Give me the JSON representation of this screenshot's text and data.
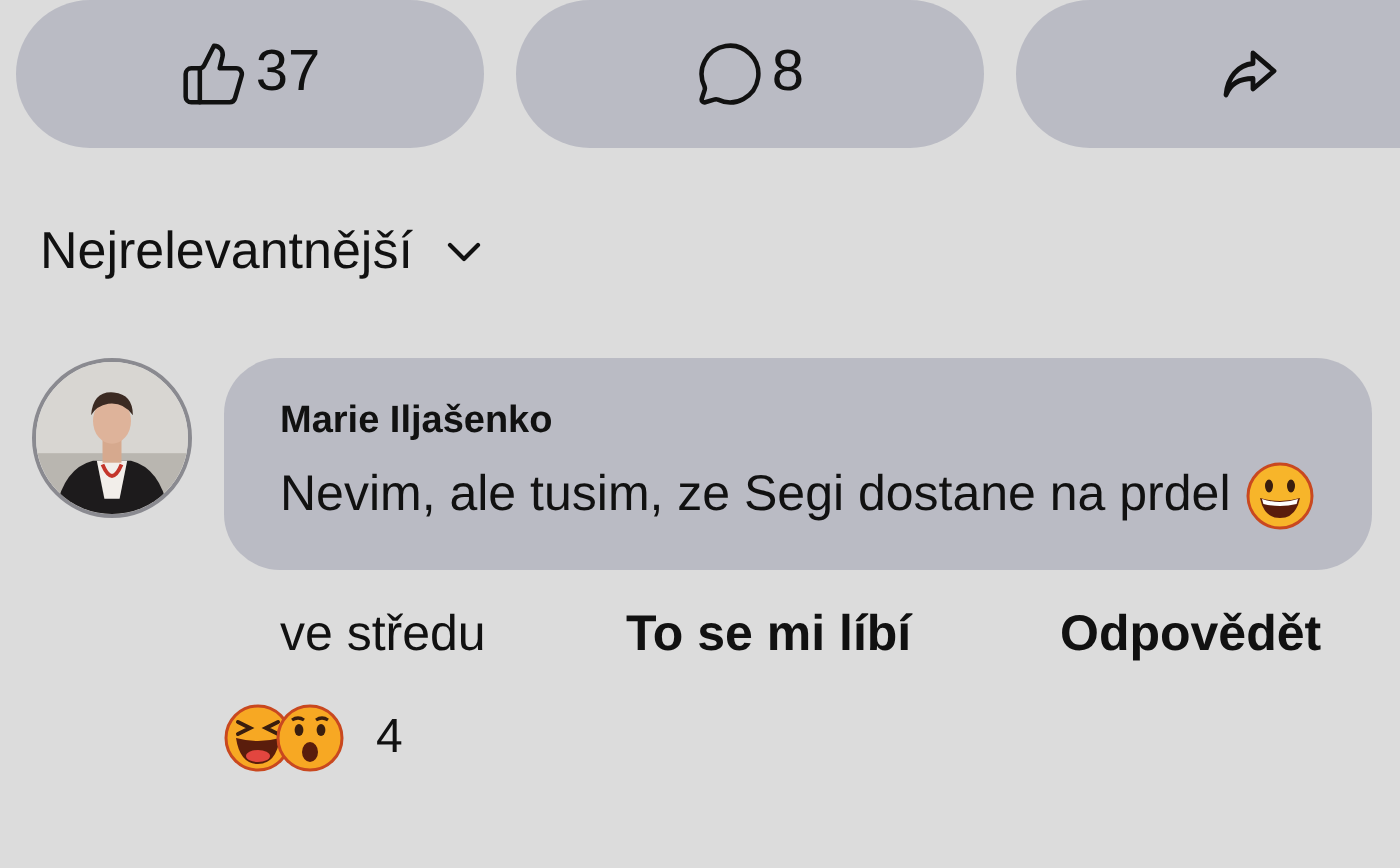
{
  "actions": [
    {
      "kind": "like",
      "label": "37"
    },
    {
      "kind": "comment",
      "label": "8"
    },
    {
      "kind": "share"
    }
  ],
  "sort": {
    "label": "Nejrelevantnější"
  },
  "comment": {
    "author": "Marie Iljašenko",
    "text": "Nevim, ale tusim, ze Segi dostane na prdel",
    "time": "ve středu",
    "like_label": "To se mi líbí",
    "reply_label": "Odpovědět",
    "reaction_count": "4"
  }
}
